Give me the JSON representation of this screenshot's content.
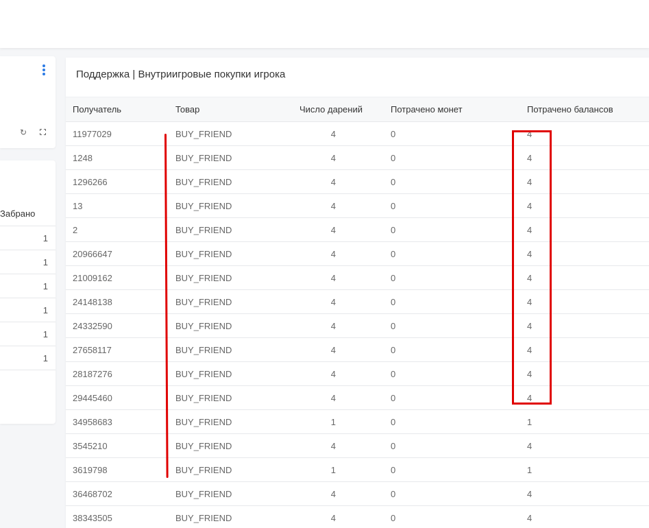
{
  "left_panel": {
    "header_label": "Забрано",
    "values": [
      "1",
      "1",
      "1",
      "1",
      "1",
      "1"
    ]
  },
  "main": {
    "title": "Поддержка | Внутриигровые покупки игрока",
    "columns": {
      "recipient": "Получатель",
      "item": "Товар",
      "gifts": "Число дарений",
      "coins": "Потрачено монет",
      "balances": "Потрачено балансов"
    },
    "rows": [
      {
        "recipient": "11977029",
        "item": "BUY_FRIEND",
        "gifts": "4",
        "coins": "0",
        "balances": "4"
      },
      {
        "recipient": "1248",
        "item": "BUY_FRIEND",
        "gifts": "4",
        "coins": "0",
        "balances": "4"
      },
      {
        "recipient": "1296266",
        "item": "BUY_FRIEND",
        "gifts": "4",
        "coins": "0",
        "balances": "4"
      },
      {
        "recipient": "13",
        "item": "BUY_FRIEND",
        "gifts": "4",
        "coins": "0",
        "balances": "4"
      },
      {
        "recipient": "2",
        "item": "BUY_FRIEND",
        "gifts": "4",
        "coins": "0",
        "balances": "4"
      },
      {
        "recipient": "20966647",
        "item": "BUY_FRIEND",
        "gifts": "4",
        "coins": "0",
        "balances": "4"
      },
      {
        "recipient": "21009162",
        "item": "BUY_FRIEND",
        "gifts": "4",
        "coins": "0",
        "balances": "4"
      },
      {
        "recipient": "24148138",
        "item": "BUY_FRIEND",
        "gifts": "4",
        "coins": "0",
        "balances": "4"
      },
      {
        "recipient": "24332590",
        "item": "BUY_FRIEND",
        "gifts": "4",
        "coins": "0",
        "balances": "4"
      },
      {
        "recipient": "27658117",
        "item": "BUY_FRIEND",
        "gifts": "4",
        "coins": "0",
        "balances": "4"
      },
      {
        "recipient": "28187276",
        "item": "BUY_FRIEND",
        "gifts": "4",
        "coins": "0",
        "balances": "4"
      },
      {
        "recipient": "29445460",
        "item": "BUY_FRIEND",
        "gifts": "4",
        "coins": "0",
        "balances": "4"
      },
      {
        "recipient": "34958683",
        "item": "BUY_FRIEND",
        "gifts": "1",
        "coins": "0",
        "balances": "1"
      },
      {
        "recipient": "3545210",
        "item": "BUY_FRIEND",
        "gifts": "4",
        "coins": "0",
        "balances": "4"
      },
      {
        "recipient": "3619798",
        "item": "BUY_FRIEND",
        "gifts": "1",
        "coins": "0",
        "balances": "1"
      },
      {
        "recipient": "36468702",
        "item": "BUY_FRIEND",
        "gifts": "4",
        "coins": "0",
        "balances": "4"
      },
      {
        "recipient": "38343505",
        "item": "BUY_FRIEND",
        "gifts": "4",
        "coins": "0",
        "balances": "4"
      }
    ]
  },
  "icons": {
    "menu": "kebab-menu-icon",
    "refresh": "refresh-icon",
    "expand": "expand-icon"
  },
  "colors": {
    "accent": "#2c7be5",
    "annotation": "#e00000"
  }
}
